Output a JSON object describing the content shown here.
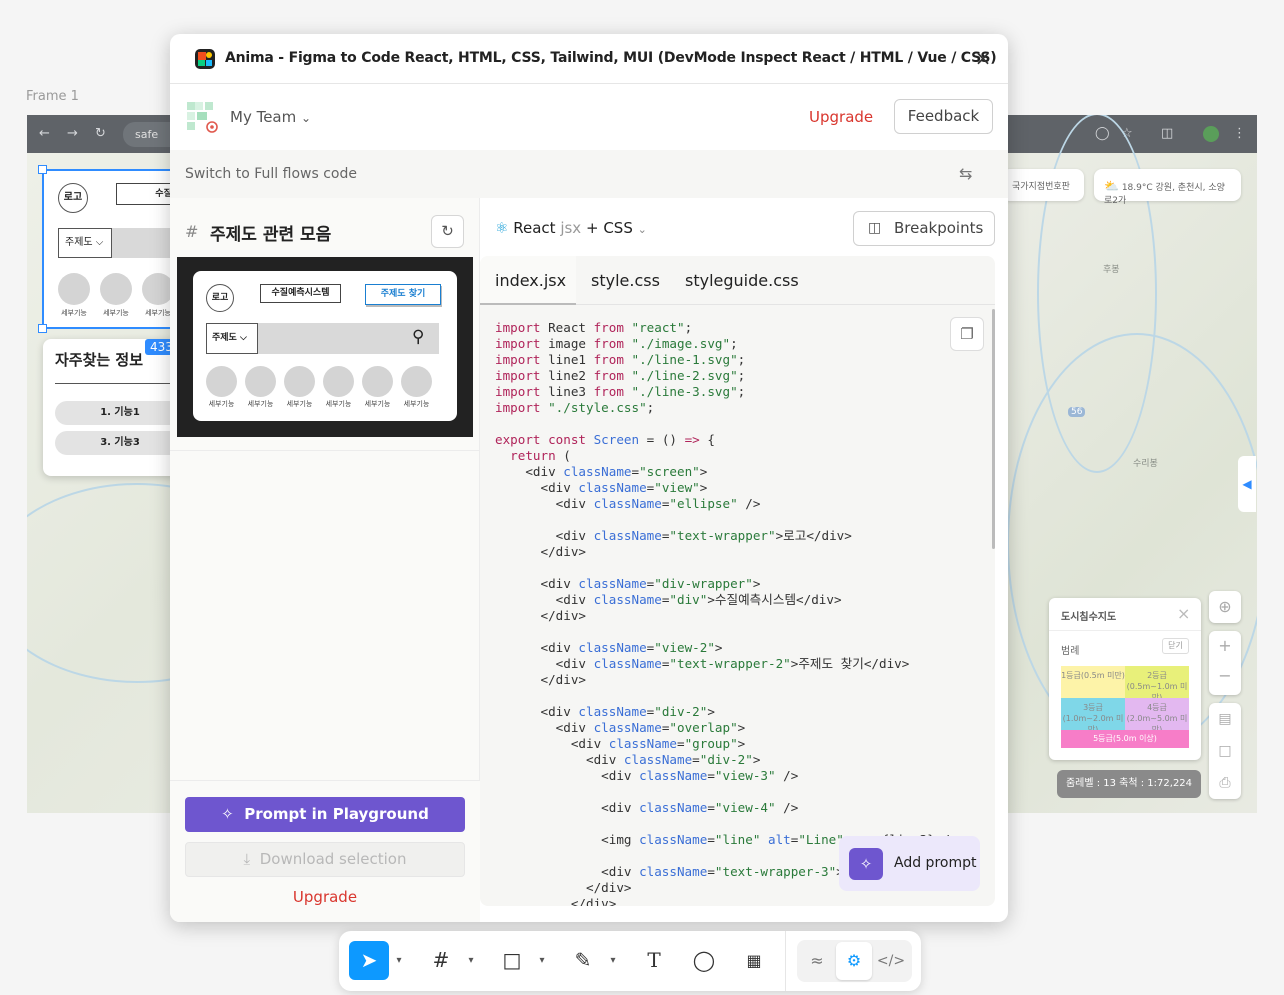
{
  "canvas": {
    "frame_label": "Frame 1",
    "browser": {
      "url_fragment": "safe"
    },
    "map": {
      "places": [
        "후봉",
        "수리봉"
      ],
      "chips": [
        "국가지점번호판",
        "18.9°C 강원, 춘천시, 소양로2가"
      ],
      "road_badge": "56"
    },
    "wireframe": {
      "logo": "로고",
      "system_title": "수질예측시",
      "dropdown": "주제도",
      "features": [
        "세부기능",
        "세부기능",
        "세부기능"
      ]
    },
    "info_card": {
      "title": "자주찾는 정보",
      "items": [
        "1. 기능1",
        "3. 기능3"
      ],
      "badge": "433"
    },
    "legend": {
      "title": "도시침수지도",
      "subtitle": "범례",
      "close_label": "닫기",
      "grades": [
        "1등급(0.5m 미만)",
        "2등급(0.5m~1.0m 미만)",
        "3등급(1.0m~2.0m 미만)",
        "4등급(2.0m~5.0m 미만)",
        "5등급(5.0m 이상)"
      ],
      "colors": [
        "#fdf3a8",
        "#e8f07a",
        "#7fd7e8",
        "#e3b8f0",
        "#f77dc8"
      ]
    },
    "scale_text": "줌레벨 : 13   축척 : 1:72,224"
  },
  "plugin": {
    "title": "Anima - Figma to Code React, HTML, CSS, Tailwind, MUI (DevMode Inspect React / HTML / Vue / CSS)",
    "team": "My Team",
    "upgrade": "Upgrade",
    "feedback": "Feedback",
    "switch_label": "Switch to Full flows code",
    "frame_name": "주제도 관련 모음",
    "preview": {
      "logo": "로고",
      "system_title": "수질예측시스템",
      "find_button": "주제도 찾기",
      "dropdown": "주제도",
      "features": [
        "세부기능",
        "세부기능",
        "세부기능",
        "세부기능",
        "세부기능",
        "세부기능"
      ]
    },
    "prompt_button": "Prompt in Playground",
    "download_button": "Download selection",
    "upgrade_bottom": "Upgrade",
    "framework": {
      "name": "React",
      "ext": "jsx",
      "plus": "+",
      "style": "CSS"
    },
    "breakpoints": "Breakpoints",
    "tabs": [
      "index.jsx",
      "style.css",
      "styleguide.css"
    ],
    "add_prompt": "Add prompt"
  },
  "colors": {
    "accent_purple": "#6e56cf",
    "upgrade_red": "#d9362e",
    "figma_blue": "#0d99ff"
  },
  "toolbar": {
    "tools": [
      "move-icon",
      "frame-icon",
      "rectangle-icon",
      "pen-icon",
      "text-icon",
      "comment-icon",
      "components-icon"
    ],
    "dev_tools": [
      "draw-icon",
      "devmode-icon",
      "code-icon"
    ]
  }
}
